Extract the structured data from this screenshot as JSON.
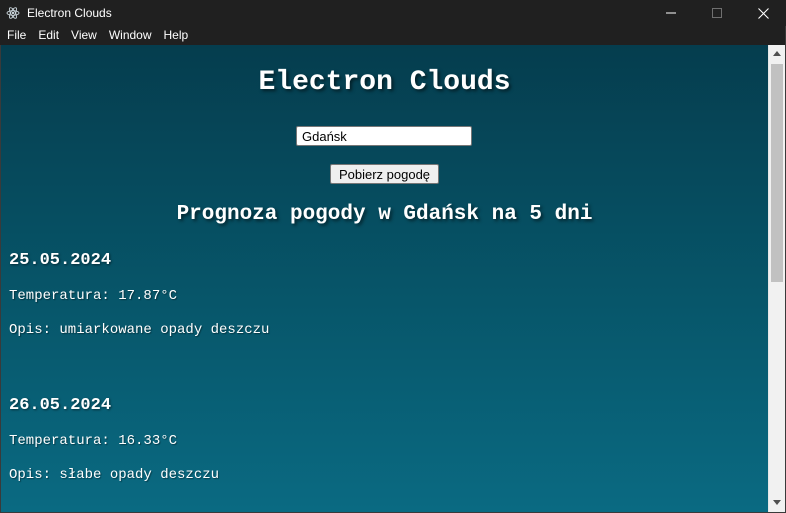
{
  "window": {
    "title": "Electron Clouds",
    "icon": "electron-icon",
    "controls": [
      "minimize-icon",
      "maximize-icon",
      "close-icon"
    ]
  },
  "menu": {
    "items": [
      {
        "label": "File"
      },
      {
        "label": "Edit"
      },
      {
        "label": "View"
      },
      {
        "label": "Window"
      },
      {
        "label": "Help"
      }
    ]
  },
  "app": {
    "title": "Electron Clouds",
    "city_input_value": "Gdańsk",
    "fetch_button_label": "Pobierz pogodę",
    "forecast_heading": "Prognoza pogody w Gdańsk na 5 dni"
  },
  "forecast": [
    {
      "date": "25.05.2024",
      "temperature": "Temperatura: 17.87°C",
      "description": "Opis: umiarkowane opady deszczu"
    },
    {
      "date": "26.05.2024",
      "temperature": "Temperatura: 16.33°C",
      "description": "Opis: słabe opady deszczu"
    }
  ],
  "colors": {
    "titlebar": "#202020",
    "background_top": "#053d4e",
    "background_bottom": "#0a6a82",
    "text": "#ffffff"
  }
}
